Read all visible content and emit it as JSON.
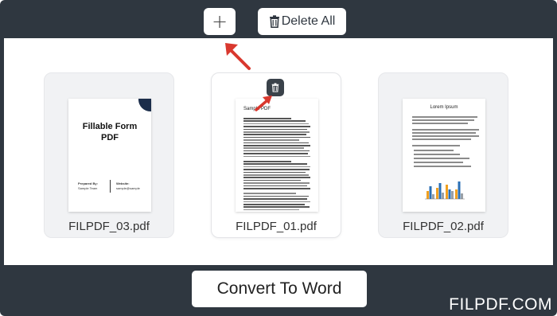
{
  "toolbar": {
    "add_label": "+",
    "delete_all_label": "Delete All"
  },
  "files": [
    {
      "name": "FILPDF_03.pdf",
      "cover_title": "Fillable Form PDF",
      "prepared_by": "Prepared By:",
      "prepared_name": "Sample Team",
      "website": "Website:",
      "website_value": "sample@sample"
    },
    {
      "name": "FILPDF_01.pdf",
      "heading": "Sample PDF"
    },
    {
      "name": "FILPDF_02.pdf",
      "heading": "Lorem Ipsum"
    }
  ],
  "actions": {
    "convert_label": "Convert To Word"
  },
  "brand": "FILPDF.COM",
  "colors": {
    "frame": "#2f3740",
    "arrow": "#d9382e",
    "bar_orange": "#f0a020",
    "bar_blue": "#2a6fb5",
    "bar_gray": "#9aa0a6"
  },
  "icons": [
    "plus-icon",
    "trash-icon",
    "arrow-icon"
  ]
}
